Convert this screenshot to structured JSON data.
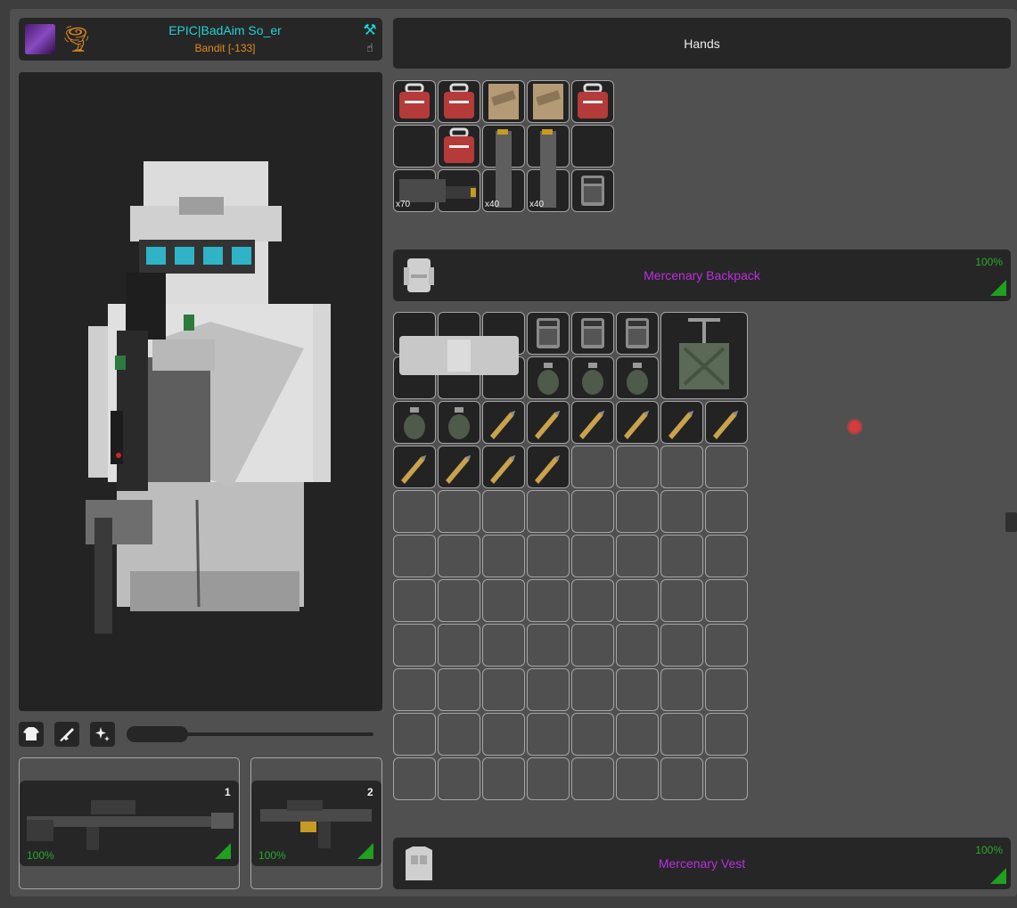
{
  "player": {
    "name": "EPIC|BadAim So_er",
    "reputation": "Bandit [-133]",
    "avatar_icon": "player-avatar",
    "clan_icon": "orange-tornado-icon",
    "hammer_icon": "hammer-icon",
    "hand_icon": "hand-cursor-icon"
  },
  "hands": {
    "label": "Hands"
  },
  "toolbar": {
    "buttons": [
      {
        "icon": "shirt-icon",
        "glyph": "👕"
      },
      {
        "icon": "rifle-icon",
        "glyph": "⚔"
      },
      {
        "icon": "sparkle-icon",
        "glyph": "✨"
      }
    ]
  },
  "weapons": [
    {
      "slot": "1",
      "durability": "100%"
    },
    {
      "slot": "2",
      "durability": "100%"
    }
  ],
  "pockets": {
    "items": [
      {
        "kind": "medkit",
        "qty": ""
      },
      {
        "kind": "medkit",
        "qty": ""
      },
      {
        "kind": "mre",
        "qty": ""
      },
      {
        "kind": "mre",
        "qty": ""
      },
      {
        "kind": "medkit",
        "qty": ""
      },
      {
        "kind": "magazine-tall",
        "qty": "x40"
      },
      {
        "kind": "magazine-tall",
        "qty": "x40"
      },
      {
        "kind": "medkit",
        "qty": ""
      },
      {
        "kind": "ammo-box",
        "qty": "x70"
      },
      {
        "kind": "radio",
        "qty": ""
      }
    ]
  },
  "backpack": {
    "name": "Mercenary Backpack",
    "durability": "100%",
    "icon": "backpack-icon"
  },
  "vest": {
    "name": "Mercenary Vest",
    "durability": "100%",
    "icon": "vest-icon"
  },
  "colors": {
    "accent_cyan": "#21d3d6",
    "bandit_orange": "#e08a20",
    "item_purple": "#bc2fe0",
    "durability_green": "#2ba82b"
  }
}
